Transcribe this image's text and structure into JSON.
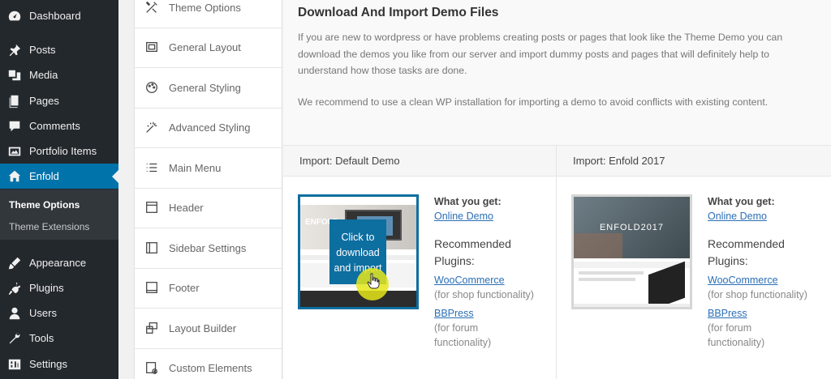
{
  "wp_menu": {
    "items": [
      {
        "label": "Dashboard",
        "icon": "dashboard-icon"
      },
      {
        "label": "Posts",
        "icon": "pin-icon"
      },
      {
        "label": "Media",
        "icon": "media-icon"
      },
      {
        "label": "Pages",
        "icon": "pages-icon"
      },
      {
        "label": "Comments",
        "icon": "comments-icon"
      },
      {
        "label": "Portfolio Items",
        "icon": "portfolio-icon"
      },
      {
        "label": "Enfold",
        "icon": "home-icon",
        "active": true
      },
      {
        "label": "Appearance",
        "icon": "brush-icon"
      },
      {
        "label": "Plugins",
        "icon": "plug-icon"
      },
      {
        "label": "Users",
        "icon": "user-icon"
      },
      {
        "label": "Tools",
        "icon": "wrench-icon"
      },
      {
        "label": "Settings",
        "icon": "settings-icon"
      }
    ],
    "submenu": [
      {
        "label": "Theme Options",
        "current": true
      },
      {
        "label": "Theme Extensions"
      }
    ]
  },
  "options_nav": [
    {
      "label": "Theme Options",
      "icon": "tools-icon"
    },
    {
      "label": "General Layout",
      "icon": "layout-icon"
    },
    {
      "label": "General Styling",
      "icon": "palette-icon"
    },
    {
      "label": "Advanced Styling",
      "icon": "magic-wand-icon"
    },
    {
      "label": "Main Menu",
      "icon": "menu-list-icon"
    },
    {
      "label": "Header",
      "icon": "header-icon"
    },
    {
      "label": "Sidebar Settings",
      "icon": "sidebar-icon"
    },
    {
      "label": "Footer",
      "icon": "footer-icon"
    },
    {
      "label": "Layout Builder",
      "icon": "layout-builder-icon"
    },
    {
      "label": "Custom Elements",
      "icon": "custom-elements-icon"
    }
  ],
  "main": {
    "title": "Download And Import Demo Files",
    "intro": "If you are new to wordpress or have problems creating posts or pages that look like the Theme Demo you can download the demos you like from our server and import dummy posts and pages that will definitely help to understand how those tasks are done.",
    "recommend": "We recommend to use a clean WP installation for importing a demo to avoid conflicts with existing content."
  },
  "demos": [
    {
      "heading": "Import: Default Demo",
      "thumb_title": "ENFOLD",
      "overlay": "Click to download and import",
      "what_you_get": "What you get:",
      "online_demo": "Online Demo",
      "rec_plugins": "Recommended Plugins:",
      "plugin1": "WooCommerce",
      "plugin1_note": "(for shop functionality)",
      "plugin2": "BBPress",
      "plugin2_note_a": "(for forum",
      "plugin2_note_b": "functionality)"
    },
    {
      "heading": "Import: Enfold 2017",
      "thumb_title": "ENFOLD2017",
      "what_you_get": "What you get:",
      "online_demo": "Online Demo",
      "rec_plugins": "Recommended Plugins:",
      "plugin1": "WooCommerce",
      "plugin1_note": "(for shop functionality)",
      "plugin2": "BBPress",
      "plugin2_note_a": "(for forum",
      "plugin2_note_b": "functionality)"
    }
  ],
  "colors": {
    "accent": "#0073aa",
    "menu_bg": "#23282d",
    "overlay": "#0d6ea0",
    "highlight": "#e6e61a"
  }
}
